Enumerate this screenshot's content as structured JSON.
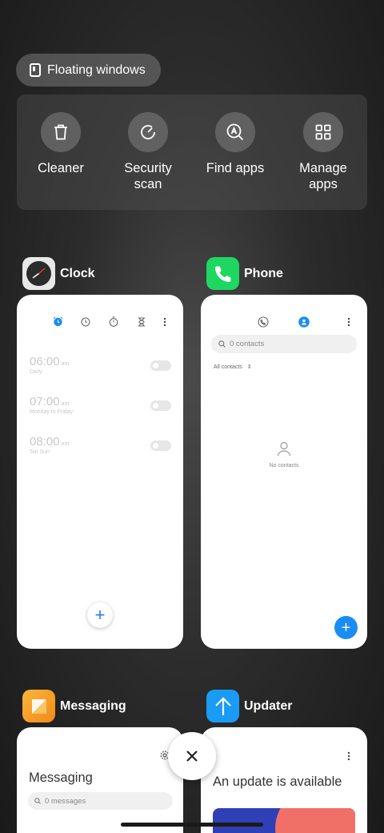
{
  "floating_windows": {
    "label": "Floating windows",
    "icon": "floating-window-icon"
  },
  "tools": [
    {
      "label": "Cleaner",
      "icon": "trash-icon"
    },
    {
      "label": "Security scan",
      "icon": "security-scan-icon"
    },
    {
      "label": "Find apps",
      "icon": "find-apps-icon"
    },
    {
      "label": "Manage apps",
      "icon": "grid-icon"
    }
  ],
  "clock": {
    "title": "Clock",
    "alarms": [
      {
        "time": "06:00",
        "ampm": "am",
        "repeat": "Daily"
      },
      {
        "time": "07:00",
        "ampm": "am",
        "repeat": "Monday to Friday"
      },
      {
        "time": "08:00",
        "ampm": "am",
        "repeat": "Sat Sun"
      }
    ]
  },
  "phone": {
    "title": "Phone",
    "search_placeholder": "0 contacts",
    "filter": "All contacts",
    "empty": "No contacts"
  },
  "messaging": {
    "title": "Messaging",
    "heading": "Messaging",
    "search_placeholder": "0 messages"
  },
  "updater": {
    "title": "Updater",
    "heading": "An update is available"
  },
  "colors": {
    "accent_blue": "#1a8df5",
    "phone_green": "#1ed760",
    "updater_blue": "#1a9bf5",
    "messaging_orange": "#f7a21b"
  }
}
